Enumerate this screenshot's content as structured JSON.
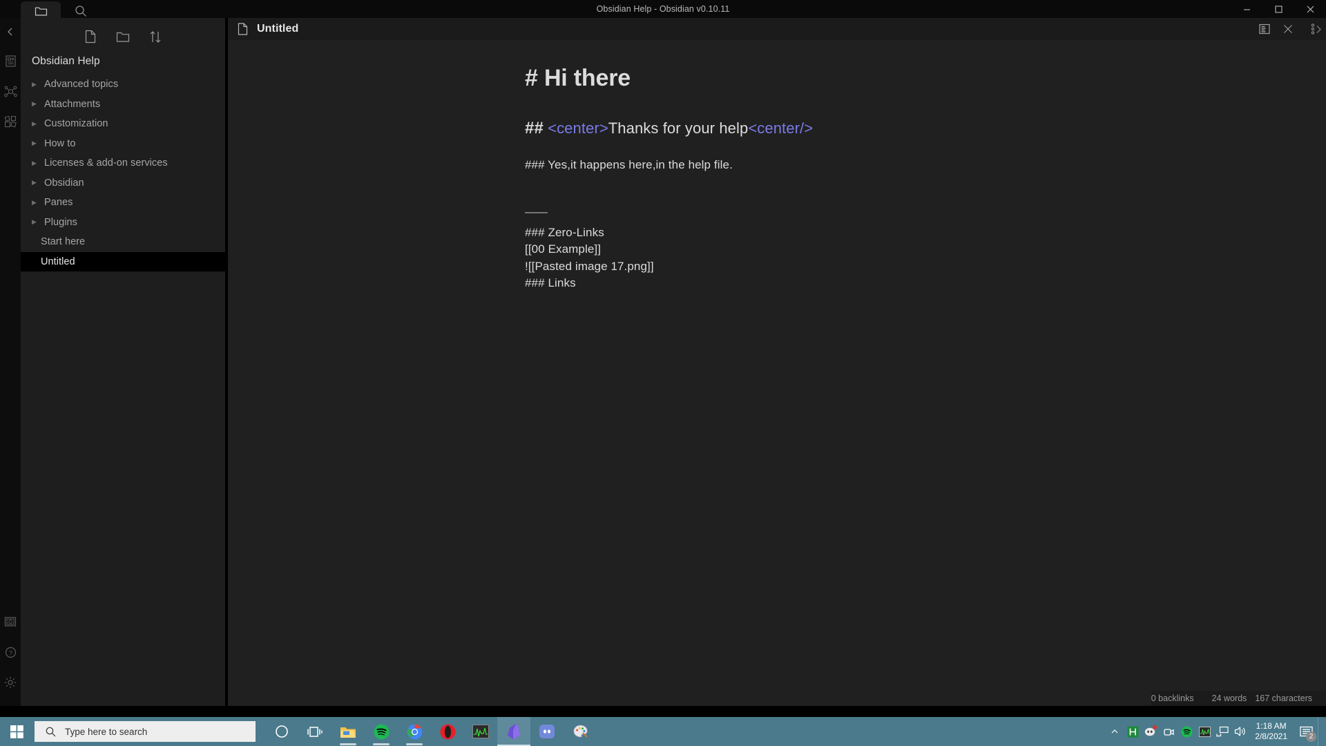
{
  "window": {
    "title": "Obsidian Help - Obsidian v0.10.11",
    "back_icon": "←",
    "forward_icon": "→",
    "minimize_icon": "minimize-icon",
    "maximize_icon": "maximize-icon",
    "close_icon": "close-icon"
  },
  "ribbon": {
    "collapse_icon": "chevron-left-icon",
    "items": [
      {
        "name": "quick-switcher-icon"
      },
      {
        "name": "graph-view-icon"
      },
      {
        "name": "plugins-icon"
      }
    ],
    "bottom_items": [
      {
        "name": "vault-switcher-icon"
      },
      {
        "name": "help-icon"
      },
      {
        "name": "settings-icon"
      }
    ]
  },
  "sidebar": {
    "tabs": [
      {
        "name": "files-tab",
        "icon": "folder-icon",
        "active": true
      },
      {
        "name": "search-tab",
        "icon": "search-icon",
        "active": false
      }
    ],
    "toolbar": [
      {
        "name": "new-note-button",
        "icon": "new-file-icon"
      },
      {
        "name": "new-folder-button",
        "icon": "new-folder-icon"
      },
      {
        "name": "change-sort-order-button",
        "icon": "sort-icon"
      }
    ],
    "vault_title": "Obsidian Help",
    "items": [
      {
        "label": "Advanced topics",
        "type": "folder"
      },
      {
        "label": "Attachments",
        "type": "folder"
      },
      {
        "label": "Customization",
        "type": "folder"
      },
      {
        "label": "How to",
        "type": "folder"
      },
      {
        "label": "Licenses & add-on services",
        "type": "folder"
      },
      {
        "label": "Obsidian",
        "type": "folder"
      },
      {
        "label": "Panes",
        "type": "folder"
      },
      {
        "label": "Plugins",
        "type": "folder"
      },
      {
        "label": "Start here",
        "type": "file",
        "active": false
      },
      {
        "label": "Untitled",
        "type": "file",
        "active": true
      }
    ],
    "caret_glyph": "▶"
  },
  "view_header": {
    "file_icon": "file-icon",
    "title": "Untitled",
    "actions": [
      {
        "name": "reading-view-button",
        "icon": "reading-view-icon"
      },
      {
        "name": "close-pane-button",
        "icon": "close-icon"
      },
      {
        "name": "more-options-button",
        "icon": "more-vertical-icon"
      }
    ]
  },
  "editor": {
    "lines": [
      {
        "kind": "h1",
        "text": "# Hi there"
      },
      {
        "kind": "blank-lg"
      },
      {
        "kind": "h2",
        "hashes": "##",
        "prefix_tag": "<center>",
        "mid": "Thanks for your help",
        "suffix_tag": "<center/>"
      },
      {
        "kind": "blank"
      },
      {
        "kind": "text",
        "text": "### Yes,it happens here,in the help file."
      },
      {
        "kind": "blank"
      },
      {
        "kind": "blank"
      },
      {
        "kind": "hr",
        "text": "——"
      },
      {
        "kind": "text",
        "text": "### Zero-Links"
      },
      {
        "kind": "text",
        "text": "[[00 Example]]"
      },
      {
        "kind": "text",
        "text": "![[Pasted image 17.png]]"
      },
      {
        "kind": "text",
        "text": "### Links"
      }
    ]
  },
  "statusbar": {
    "backlinks": "0 backlinks",
    "words": "24 words",
    "characters": "167 characters"
  },
  "taskbar": {
    "start_icon": "windows-start-icon",
    "search_placeholder": "Type here to search",
    "search_icon": "search-icon",
    "apps": [
      {
        "name": "cortana-icon",
        "label": "Cortana"
      },
      {
        "name": "task-view-icon",
        "label": "Task View"
      },
      {
        "name": "file-explorer-icon",
        "label": "File Explorer"
      },
      {
        "name": "spotify-icon",
        "label": "Spotify"
      },
      {
        "name": "chrome-icon",
        "label": "Google Chrome"
      },
      {
        "name": "opera-icon",
        "label": "Opera"
      },
      {
        "name": "task-manager-icon",
        "label": "Task Manager"
      },
      {
        "name": "obsidian-icon",
        "label": "Obsidian"
      },
      {
        "name": "discord-icon",
        "label": "Discord"
      },
      {
        "name": "paint-icon",
        "label": "Paint"
      }
    ],
    "tray": {
      "expand_icon": "chevron-up-icon",
      "icons": [
        {
          "name": "hyper-v-icon"
        },
        {
          "name": "discord-tray-icon"
        },
        {
          "name": "camera-tray-icon"
        },
        {
          "name": "spotify-tray-icon"
        },
        {
          "name": "task-manager-tray-icon"
        },
        {
          "name": "network-icon"
        },
        {
          "name": "volume-icon"
        }
      ],
      "time": "1:18 AM",
      "date": "2/8/2021",
      "notification_icon": "action-center-icon",
      "notification_count": "2"
    }
  },
  "colors": {
    "accent_purple": "#7a7ae8",
    "taskbar": "#4a7a8c",
    "sidebar_bg": "#1e1e1e",
    "editor_bg": "#202020"
  }
}
